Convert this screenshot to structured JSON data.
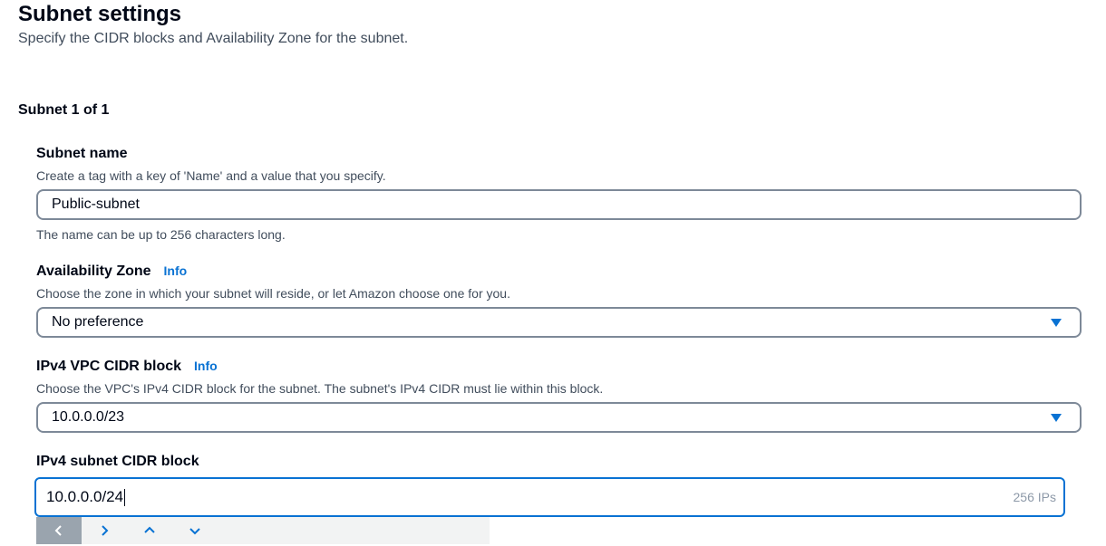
{
  "section": {
    "title": "Subnet settings",
    "description": "Specify the CIDR blocks and Availability Zone for the subnet."
  },
  "subnet_counter": "Subnet 1 of 1",
  "subnet_name": {
    "label": "Subnet name",
    "description": "Create a tag with a key of 'Name' and a value that you specify.",
    "value": "Public-subnet",
    "constraint": "The name can be up to 256 characters long."
  },
  "availability_zone": {
    "label": "Availability Zone",
    "info": "Info",
    "description": "Choose the zone in which your subnet will reside, or let Amazon choose one for you.",
    "value": "No preference"
  },
  "vpc_cidr": {
    "label": "IPv4 VPC CIDR block",
    "info": "Info",
    "description": "Choose the VPC's IPv4 CIDR block for the subnet. The subnet's IPv4 CIDR must lie within this block.",
    "value": "10.0.0.0/23"
  },
  "subnet_cidr": {
    "label": "IPv4 subnet CIDR block",
    "value": "10.0.0.0/24",
    "ip_count": "256 IPs"
  },
  "nav_toolbar": {
    "buttons": [
      "chevron-left-icon",
      "chevron-right-icon",
      "chevron-up-icon",
      "chevron-down-icon"
    ]
  },
  "colors": {
    "link": "#0972d3",
    "focus_border": "#0972d3",
    "input_border": "#7d8998",
    "text_primary": "#000716",
    "text_secondary": "#414d5c"
  }
}
